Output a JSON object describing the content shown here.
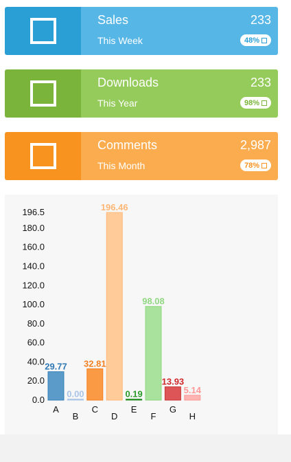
{
  "cards": [
    {
      "title": "Sales",
      "subtitle": "This Week",
      "value": "233",
      "badge": "48%",
      "icon": "square-icon",
      "dark": "#2a9fd6",
      "light": "#56b6e6"
    },
    {
      "title": "Downloads",
      "subtitle": "This Year",
      "value": "233",
      "badge": "98%",
      "icon": "square-icon",
      "dark": "#7ab43a",
      "light": "#94cb5a"
    },
    {
      "title": "Comments",
      "subtitle": "This Month",
      "value": "2,987",
      "badge": "78%",
      "icon": "square-icon",
      "dark": "#f7931e",
      "light": "#fbac4f"
    }
  ],
  "chart_data": {
    "type": "bar",
    "categories": [
      "A",
      "B",
      "C",
      "D",
      "E",
      "F",
      "G",
      "H"
    ],
    "values": [
      29.77,
      0.0,
      32.81,
      196.46,
      0.19,
      98.08,
      13.93,
      5.14
    ],
    "value_labels": [
      "29.77",
      "0.00",
      "32.81",
      "196.46",
      "0.19",
      "98.08",
      "13.93",
      "5.14"
    ],
    "y_ticks": [
      "0.0",
      "20.0",
      "40.0",
      "60.0",
      "80.0",
      "100.0",
      "120.0",
      "140.0",
      "160.0",
      "180.0",
      "196.5"
    ],
    "ylim": [
      0,
      196.5
    ],
    "grid": false,
    "bar_fill": [
      "#5b9bc9",
      "#c4d6ec",
      "#fb9a45",
      "#ffcb99",
      "#3ca63c",
      "#a9e29d",
      "#dd5556",
      "#fdb3b2"
    ],
    "bar_stroke": [
      "#3a80b8",
      "#a9c4e6",
      "#f47f1e",
      "#ffba7a",
      "#2a8f2a",
      "#90d782",
      "#c83435",
      "#fd9897"
    ],
    "label_color": [
      "#2f78b4",
      "#a9c4e6",
      "#f47f1e",
      "#ffb775",
      "#2a9a2a",
      "#90d782",
      "#d0282a",
      "#fd9897"
    ]
  }
}
